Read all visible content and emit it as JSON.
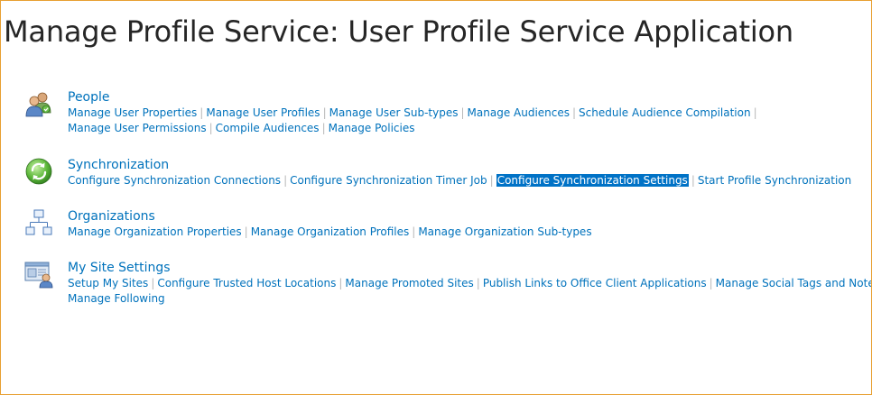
{
  "page": {
    "title": "Manage Profile Service: User Profile Service Application"
  },
  "sections": [
    {
      "heading": "People",
      "icon": "people-icon",
      "lines": [
        [
          "Manage User Properties",
          "Manage User Profiles",
          "Manage User Sub-types",
          "Manage Audiences",
          "Schedule Audience Compilation"
        ],
        [
          "Manage User Permissions",
          "Compile Audiences",
          "Manage Policies"
        ]
      ],
      "line_trailing_separator": [
        true,
        false
      ]
    },
    {
      "heading": "Synchronization",
      "icon": "sync-icon",
      "lines": [
        [
          "Configure Synchronization Connections",
          "Configure Synchronization Timer Job",
          "Configure Synchronization Settings",
          "Start Profile Synchronization"
        ]
      ],
      "line_trailing_separator": [
        false
      ],
      "selected_link": "Configure Synchronization Settings"
    },
    {
      "heading": "Organizations",
      "icon": "org-chart-icon",
      "lines": [
        [
          "Manage Organization Properties",
          "Manage Organization Profiles",
          "Manage Organization Sub-types"
        ]
      ],
      "line_trailing_separator": [
        false
      ]
    },
    {
      "heading": "My Site Settings",
      "icon": "my-site-icon",
      "lines": [
        [
          "Setup My Sites",
          "Configure Trusted Host Locations",
          "Manage Promoted Sites",
          "Publish Links to Office Client Applications",
          "Manage Social Tags and Notes"
        ],
        [
          "Manage Following"
        ]
      ],
      "line_trailing_separator": [
        true,
        false
      ]
    }
  ],
  "separator": "|",
  "colors": {
    "link": "#0072bc",
    "title": "#262626",
    "selection": "#0072c6",
    "separator": "#b8b8b8",
    "frame": "#e8a032"
  }
}
